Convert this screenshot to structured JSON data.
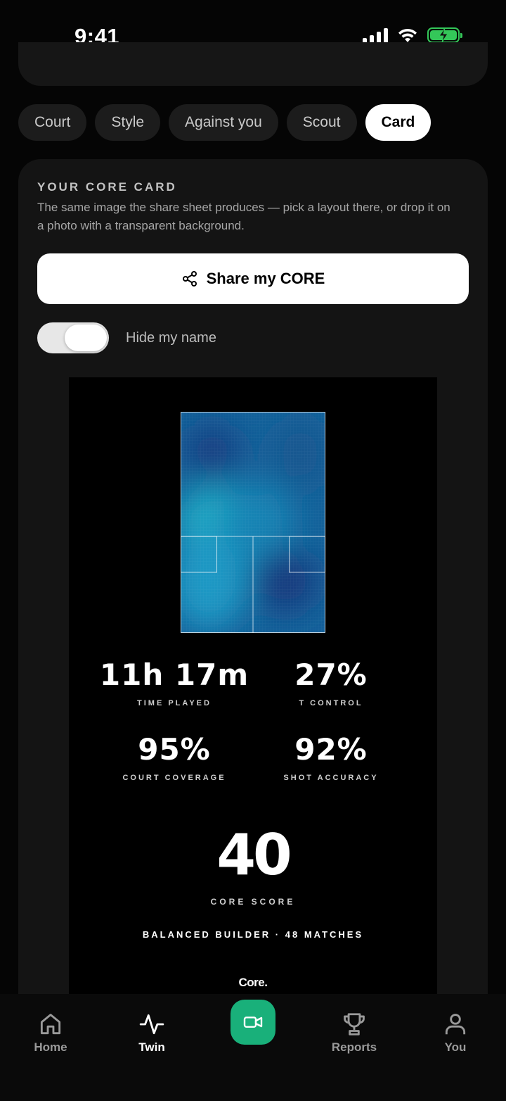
{
  "status": {
    "time": "9:41"
  },
  "tabs": [
    {
      "label": "Court",
      "active": false
    },
    {
      "label": "Style",
      "active": false
    },
    {
      "label": "Against you",
      "active": false
    },
    {
      "label": "Scout",
      "active": false
    },
    {
      "label": "Card",
      "active": true
    }
  ],
  "card": {
    "title": "YOUR CORE CARD",
    "description": "The same image the share sheet produces — pick a layout there, or drop it on a photo with a transparent background.",
    "share_label": "Share my CORE",
    "toggle": {
      "label": "Hide my name",
      "on": true
    }
  },
  "preview": {
    "stats": [
      {
        "value": "11h 17m",
        "label": "TIME PLAYED"
      },
      {
        "value": "27%",
        "label": "T CONTROL"
      },
      {
        "value": "95%",
        "label": "COURT COVERAGE"
      },
      {
        "value": "92%",
        "label": "SHOT ACCURACY"
      }
    ],
    "score": "40",
    "score_label": "CORE SCORE",
    "archetype": "BALANCED BUILDER · 48 MATCHES",
    "brand": "Core."
  },
  "nav": [
    {
      "label": "Home",
      "icon": "home-icon",
      "active": false
    },
    {
      "label": "Twin",
      "icon": "pulse-icon",
      "active": true
    },
    {
      "label": "",
      "icon": "video-camera-icon",
      "active": false
    },
    {
      "label": "Reports",
      "icon": "trophy-icon",
      "active": false
    },
    {
      "label": "You",
      "icon": "person-icon",
      "active": false
    }
  ],
  "colors": {
    "accent": "#19b07a",
    "battery": "#34c759"
  }
}
